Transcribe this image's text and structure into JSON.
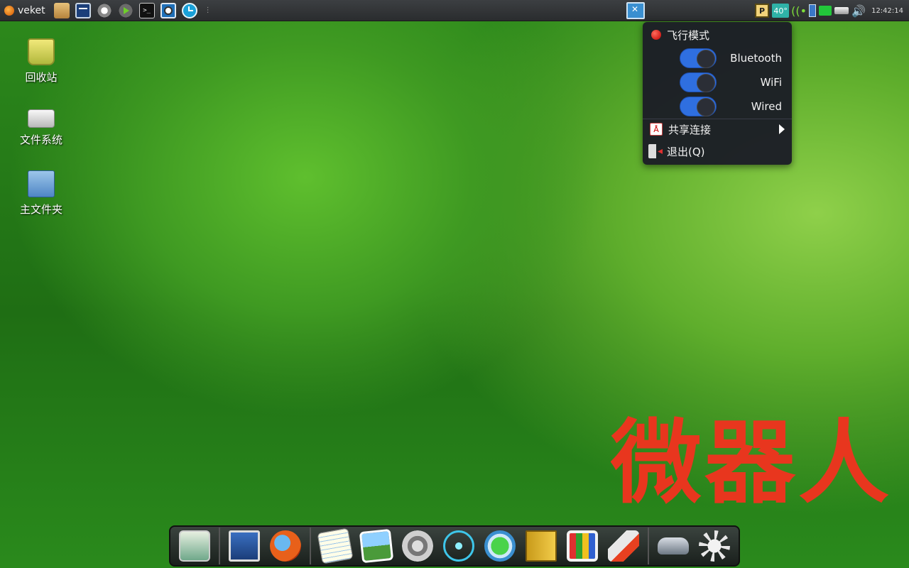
{
  "top_panel": {
    "start_label": "veket",
    "quick_icons": [
      "folder-icon",
      "system-monitor-icon",
      "settings-gears-icon",
      "run-icon",
      "terminal-icon",
      "screenshot-icon",
      "clock-icon"
    ],
    "clock": "12:42:14",
    "tray": {
      "p_label": "P",
      "temperature": "40°"
    }
  },
  "desktop": {
    "icons": [
      {
        "label": "回收站",
        "icon": "trash-icon"
      },
      {
        "label": "文件系统",
        "icon": "drive-icon"
      },
      {
        "label": "主文件夹",
        "icon": "home-folder-icon"
      }
    ]
  },
  "network_menu": {
    "airplane_mode": "飞行模式",
    "toggles": [
      {
        "label": "Bluetooth",
        "enabled": true
      },
      {
        "label": "WiFi",
        "enabled": true
      },
      {
        "label": "Wired",
        "enabled": true
      }
    ],
    "share_connection": "共享连接",
    "quit": "退出(Q)"
  },
  "watermark": "微器人",
  "dock": {
    "items": [
      "desktop-icon",
      "monitor-icon",
      "firefox-icon",
      "text-editor-icon",
      "image-viewer-icon",
      "speaker-icon",
      "atom-icon",
      "media-player-icon",
      "address-book-icon",
      "presentation-icon",
      "rocket-icon",
      "mouse-icon",
      "brightness-icon"
    ]
  },
  "colors": {
    "panel_bg": "#2e3033",
    "menu_bg": "#1c1e26",
    "toggle_on": "#2f6fe0",
    "watermark": "#e8361e"
  }
}
